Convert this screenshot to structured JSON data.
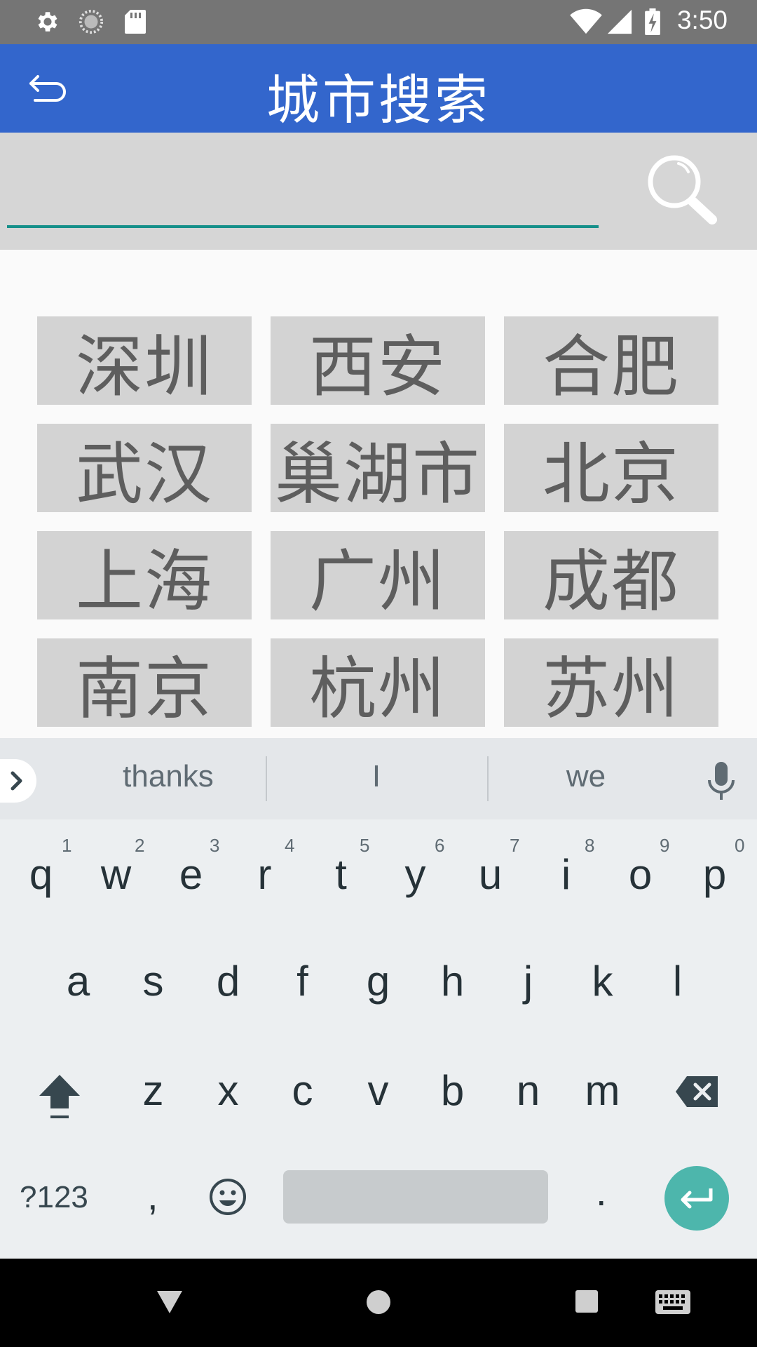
{
  "status_bar": {
    "time": "3:50",
    "icons": [
      "settings-gear-icon",
      "sync-icon",
      "sd-card-icon",
      "wifi-icon",
      "signal-icon",
      "battery-charging-icon"
    ]
  },
  "app_bar": {
    "title": "城市搜索",
    "back_icon": "back-arrow-icon",
    "color": "#3366cc"
  },
  "search": {
    "value": "",
    "placeholder": "",
    "icon": "magnifier-icon",
    "underline_color": "#16908a"
  },
  "cities": [
    "深圳",
    "西安",
    "合肥",
    "武汉",
    "巢湖市",
    "北京",
    "上海",
    "广州",
    "成都",
    "南京",
    "杭州",
    "苏州"
  ],
  "keyboard": {
    "suggestions": [
      "thanks",
      "I",
      "we"
    ],
    "row1": [
      "q",
      "w",
      "e",
      "r",
      "t",
      "y",
      "u",
      "i",
      "o",
      "p"
    ],
    "row1_hints": [
      "1",
      "2",
      "3",
      "4",
      "5",
      "6",
      "7",
      "8",
      "9",
      "0"
    ],
    "row2": [
      "a",
      "s",
      "d",
      "f",
      "g",
      "h",
      "j",
      "k",
      "l"
    ],
    "row3": [
      "z",
      "x",
      "c",
      "v",
      "b",
      "n",
      "m"
    ],
    "symbols_label": "?123",
    "comma_label": ",",
    "period_label": ".",
    "enter_color": "#4db6ac"
  },
  "nav_bar": {
    "icons": [
      "back-triangle-icon",
      "home-circle-icon",
      "recents-square-icon",
      "keyboard-switch-icon"
    ]
  }
}
